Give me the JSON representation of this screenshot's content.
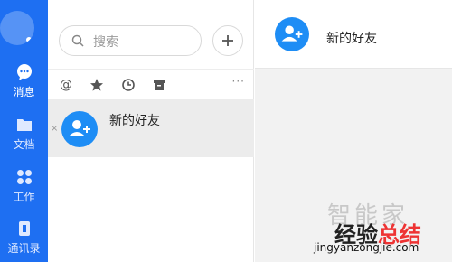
{
  "nav": {
    "items": [
      {
        "label": "消息",
        "icon": "chat-bubble-icon",
        "active": true
      },
      {
        "label": "文档",
        "icon": "folder-icon",
        "active": false
      },
      {
        "label": "工作",
        "icon": "apps-grid-icon",
        "active": false
      },
      {
        "label": "通讯录",
        "icon": "contacts-icon",
        "active": false
      }
    ]
  },
  "search": {
    "placeholder": "搜索"
  },
  "toolbar": {
    "more_label": "···"
  },
  "conversations": [
    {
      "name": "新的好友",
      "close_label": "×"
    }
  ],
  "chat_header": {
    "title": "新的好友"
  },
  "watermark": {
    "line1": "智能家",
    "line2_a": "经验",
    "line2_b": "总结",
    "line3": "jingyanzongjie.com"
  },
  "colors": {
    "accent": "#1e6ff2",
    "avatar_blue": "#1e8df5"
  }
}
